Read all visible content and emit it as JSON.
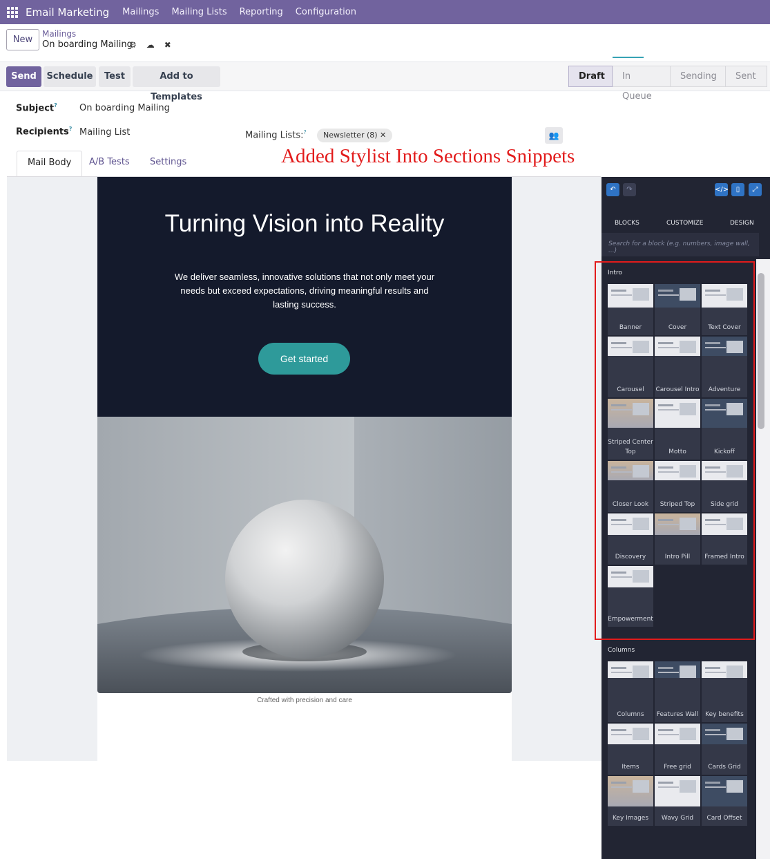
{
  "nav": {
    "app_title": "Email Marketing",
    "items": [
      "Mailings",
      "Mailing Lists",
      "Reporting",
      "Configuration"
    ]
  },
  "control_panel": {
    "new_label": "New",
    "breadcrumb_parent": "Mailings",
    "breadcrumb_current": "On boarding Mailing"
  },
  "actions": {
    "send": "Send",
    "schedule": "Schedule",
    "test": "Test",
    "add_templates": "Add to Templates"
  },
  "stages": {
    "items": [
      "Draft",
      "In Queue",
      "Sending",
      "Sent"
    ],
    "active": "Draft"
  },
  "form": {
    "subject_label": "Subject",
    "subject_value": "On boarding Mailing",
    "recipients_label": "Recipients",
    "recipients_value": "Mailing List",
    "mailing_lists_label": "Mailing Lists:",
    "mailing_list_tag": "Newsletter (8)",
    "help_mark": "?"
  },
  "tabs": [
    "Mail Body",
    "A/B Tests",
    "Settings"
  ],
  "mail": {
    "hero_title": "Turning Vision into Reality",
    "hero_text": "We deliver seamless, innovative solutions that not only meet your needs but exceed expectations, driving meaningful results and lasting success.",
    "cta": "Get started",
    "caption": "Crafted with precision and care"
  },
  "annotation": "Added Stylist Into Sections Snippets",
  "panel": {
    "tabs": [
      "BLOCKS",
      "CUSTOMIZE",
      "DESIGN"
    ],
    "search_placeholder": "Search for a block (e.g. numbers, image wall, ...)",
    "intro_title": "Intro",
    "intro_snippets": [
      "Banner",
      "Cover",
      "Text Cover",
      "Carousel",
      "Carousel Intro",
      "Adventure",
      "Striped Center Top",
      "Motto",
      "Kickoff",
      "Closer Look",
      "Striped Top",
      "Side grid",
      "Discovery",
      "Intro Pill",
      "Framed Intro",
      "Empowerment"
    ],
    "columns_title": "Columns",
    "columns_snippets": [
      "Columns",
      "Features Wall",
      "Key benefits",
      "Items",
      "Free grid",
      "Cards Grid",
      "Key Images",
      "Wavy Grid",
      "Card Offset"
    ]
  },
  "colors": {
    "brand": "#71639e",
    "hero_bg": "#141a2c",
    "cta": "#2e9a9a",
    "annotation": "#e21b1b",
    "panel_bg": "#222533"
  }
}
